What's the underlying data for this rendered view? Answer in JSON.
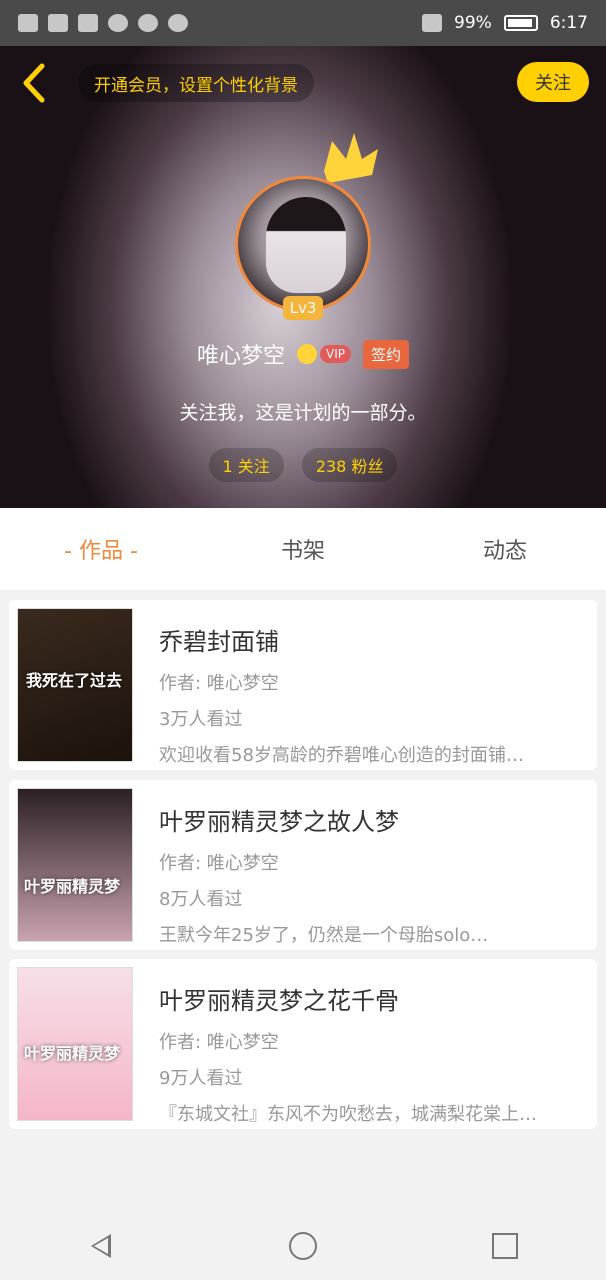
{
  "status_bar": {
    "battery_text": "99%",
    "time": "6:17"
  },
  "header": {
    "member_pill": "开通会员，设置个性化背景",
    "follow_label": "关注",
    "level": "Lv3",
    "username": "唯心梦空",
    "vip_label": "VIP",
    "sign_label": "签约",
    "signature": "关注我，这是计划的一部分。",
    "following": "1 关注",
    "fans": "238 粉丝"
  },
  "tabs": [
    {
      "label": "- 作品 -"
    },
    {
      "label": "书架"
    },
    {
      "label": "动态"
    }
  ],
  "works": [
    {
      "title": "乔碧封面铺",
      "author": "作者: 唯心梦空",
      "views": "3万人看过",
      "desc": "欢迎收看58岁高龄的乔碧唯心创造的封面铺…",
      "cover_text": "我死在了过去",
      "cover_colors": [
        "#3a2a1e",
        "#1b120c"
      ]
    },
    {
      "title": "叶罗丽精灵梦之故人梦",
      "author": "作者: 唯心梦空",
      "views": "8万人看过",
      "desc": "王默今年25岁了，仍然是一个母胎solo…",
      "cover_text": "叶罗丽精灵梦",
      "cover_colors": [
        "#2b2024",
        "#c9a3b0"
      ]
    },
    {
      "title": "叶罗丽精灵梦之花千骨",
      "author": "作者: 唯心梦空",
      "views": "9万人看过",
      "desc": "『东城文社』东风不为吹愁去，城满梨花棠上…",
      "cover_text": "叶罗丽精灵梦",
      "cover_colors": [
        "#f7dfe7",
        "#f4b6c9"
      ]
    }
  ],
  "accent": "#f0893b",
  "highlight": "#ffd000"
}
